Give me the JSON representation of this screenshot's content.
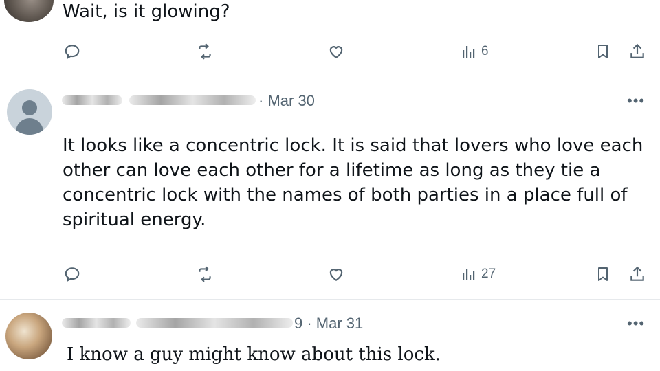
{
  "tweets": [
    {
      "text": "Wait, is it glowing?",
      "actions": {
        "views": "6"
      }
    },
    {
      "date": "· Mar 30",
      "text": "It looks like a concentric lock. It is said that lovers who love each other can love each other for a lifetime as long as they tie a concentric lock with the names of both parties in a place full of spiritual energy.",
      "actions": {
        "views": "27"
      }
    },
    {
      "date": "9 · Mar 31",
      "text": "I know a guy might know about this lock."
    }
  ],
  "more_label": "•••",
  "icons": {
    "reply": "reply-icon",
    "repost": "repost-icon",
    "like": "like-icon",
    "views": "views-icon",
    "bookmark": "bookmark-icon",
    "share": "share-icon",
    "avatar_default": "default-avatar-icon"
  },
  "colors": {
    "muted": "#536471",
    "text": "#0f1419",
    "divider": "#e6e9ec"
  }
}
